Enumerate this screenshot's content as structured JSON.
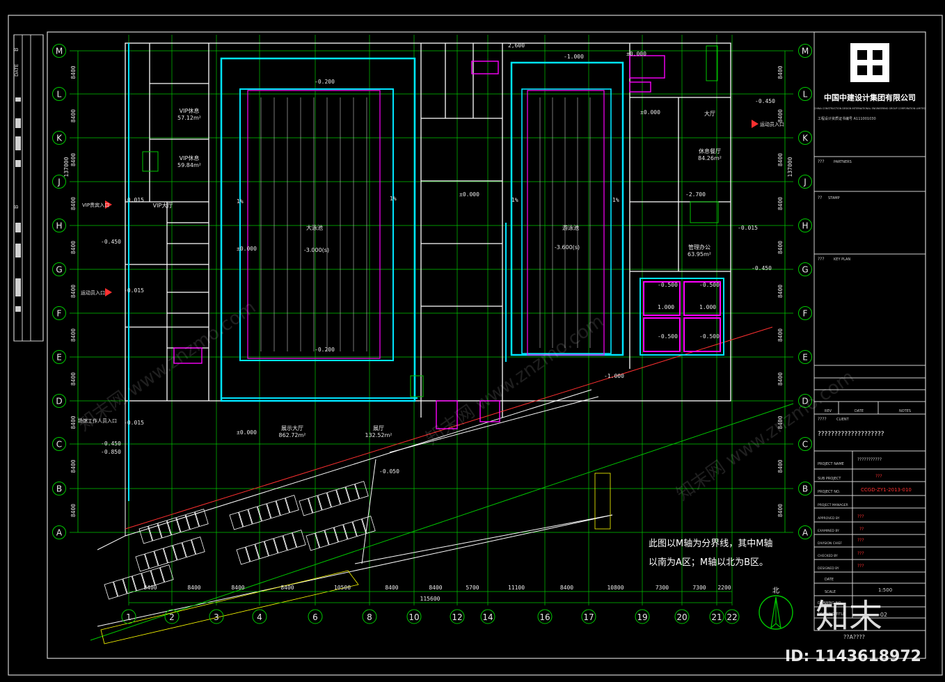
{
  "title_block": {
    "company_cn": "中国中建设计集团有限公司",
    "company_en": "CHINA CONSTRUCTION DESIGN INTERNATIONAL ENGINEERING GROUP CORPORATION LIMITED",
    "cert_line": "工程设计资质证书编号 A111001030",
    "partners_label": "PARTNERS",
    "partners_code": "???",
    "stamp_label": "STAMP",
    "stamp_code": "??",
    "keyplan_label": "KEY PLAN",
    "keyplan_code": "???",
    "rev_headers": [
      "REV",
      "DATE",
      "NOTES"
    ],
    "client_label": "CLIENT",
    "client_code": "????",
    "client_value": "????????????????????",
    "project_name_label": "PROJECT NAME",
    "project_name_value": "???????????",
    "sub_project_label": "SUB PROJECT",
    "sub_project_value": "???",
    "project_no_label": "PROJECT NO.",
    "project_no_value": "CCGD-ZY1-2013-010",
    "manager_label": "PROJECT MANAGER",
    "approved_label": "APPROVED BY",
    "approved_value": "???",
    "examined_label": "EXAMINED BY",
    "examined_value": "??",
    "division_label": "DIVISION CHIEF",
    "division_value": "???",
    "checked_label": "CHECKED BY",
    "checked_value": "???",
    "designed_label": "DESIGNED BY",
    "designed_value": "???",
    "date_label": "DATE",
    "scale_label": "SCALE",
    "scale_value": "1:500",
    "drawing_no_label": "DRAWING NO.",
    "drawing_no_value": "-02",
    "drawing_title_label": "DRAWING TITLE",
    "drawing_title_value": "??A????"
  },
  "axes": {
    "rows": [
      "M",
      "L",
      "K",
      "J",
      "H",
      "G",
      "F",
      "E",
      "D",
      "C",
      "B",
      "A"
    ],
    "row_spacing": "8400",
    "total_height": "137000",
    "columns": [
      "1",
      "2",
      "3",
      "4",
      "6",
      "8",
      "10",
      "12",
      "14",
      "16",
      "17",
      "19",
      "20",
      "21",
      "22"
    ],
    "column_dims": [
      "8400",
      "8400",
      "8400",
      "8400",
      "10500",
      "8400",
      "8400",
      "5700",
      "11100",
      "8400",
      "10800",
      "7300",
      "7300",
      "2200"
    ],
    "total_width": "115600",
    "top_dim": "2,600"
  },
  "rooms": [
    {
      "name": "大泳池",
      "level": "-3.000(s)"
    },
    {
      "name": "游泳池",
      "level": "-3.600(s)"
    },
    {
      "name": "VIP休息",
      "area": "57.12m²"
    },
    {
      "name": "VIP休息",
      "area": "59.84m²"
    },
    {
      "name": "VIP大厅"
    },
    {
      "name": "大厅"
    },
    {
      "name": "展示大厅",
      "area": "862.72m²"
    },
    {
      "name": "展厅",
      "area": "132.52m²"
    },
    {
      "name": "管理办公",
      "area": "63.95m²"
    },
    {
      "name": "休息餐厅",
      "area": "84.26m²"
    }
  ],
  "level_marks": [
    "±0.000",
    "-0.200",
    "-0.450",
    "-0.015",
    "-0.500",
    "1.000",
    "-2.700",
    "-1.000",
    "-0.050",
    "-0.850",
    "1%"
  ],
  "entrance_labels": [
    "VIP贵宾入口",
    "运动员入口",
    "运动员入口",
    "场馆工作人员入口"
  ],
  "note_line1": "此图以M轴为分界线，其中M轴",
  "note_line2": "以南为A区；M轴以北为B区。",
  "north_label": "北",
  "watermark_site": "知末网 www.znzmo.com",
  "brand_logo": "知末",
  "brand_id": "ID: 1143618972",
  "sheet_marks": {
    "left_top": "B",
    "left_mid": "B",
    "left_b2": "DATE"
  },
  "colors": {
    "background": "#000000",
    "grid": "#00c800",
    "walls": "#ffffff",
    "pool": "#00e5ff",
    "magenta": "#ff00ff",
    "red": "#ff3030",
    "yellow": "#ffff00",
    "frame": "#d0d0d0"
  }
}
